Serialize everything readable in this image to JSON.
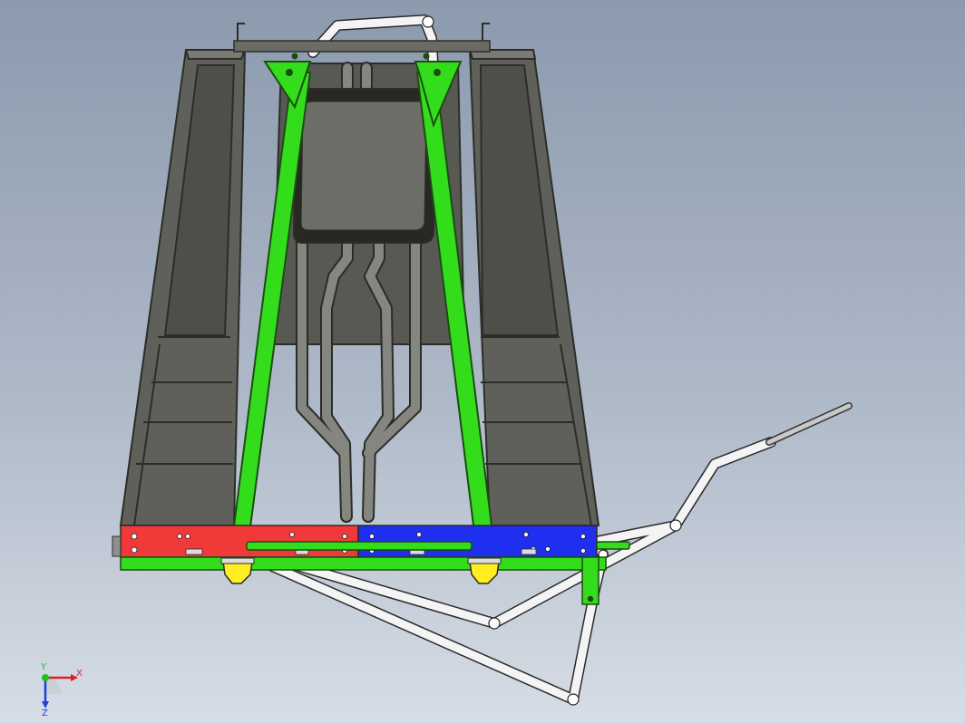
{
  "scene": {
    "background_top": "#8c9aae",
    "background_bottom": "#d7dde6",
    "colors": {
      "steel_frame": "#5f605a",
      "steel_edge": "#2c2d29",
      "green_members": "#33dd1c",
      "red_plate": "#f03a3a",
      "blue_plate": "#1f2ff0",
      "yellow_pads": "#ffee22",
      "white_linkage": "#f4f4f4",
      "exhaust_pipe": "#7a7b76"
    }
  },
  "triad": {
    "x_label": "X",
    "y_label": "Y",
    "z_label": "Z",
    "x_color": "#e02020",
    "y_color": "#20c020",
    "z_color": "#2040e0"
  }
}
